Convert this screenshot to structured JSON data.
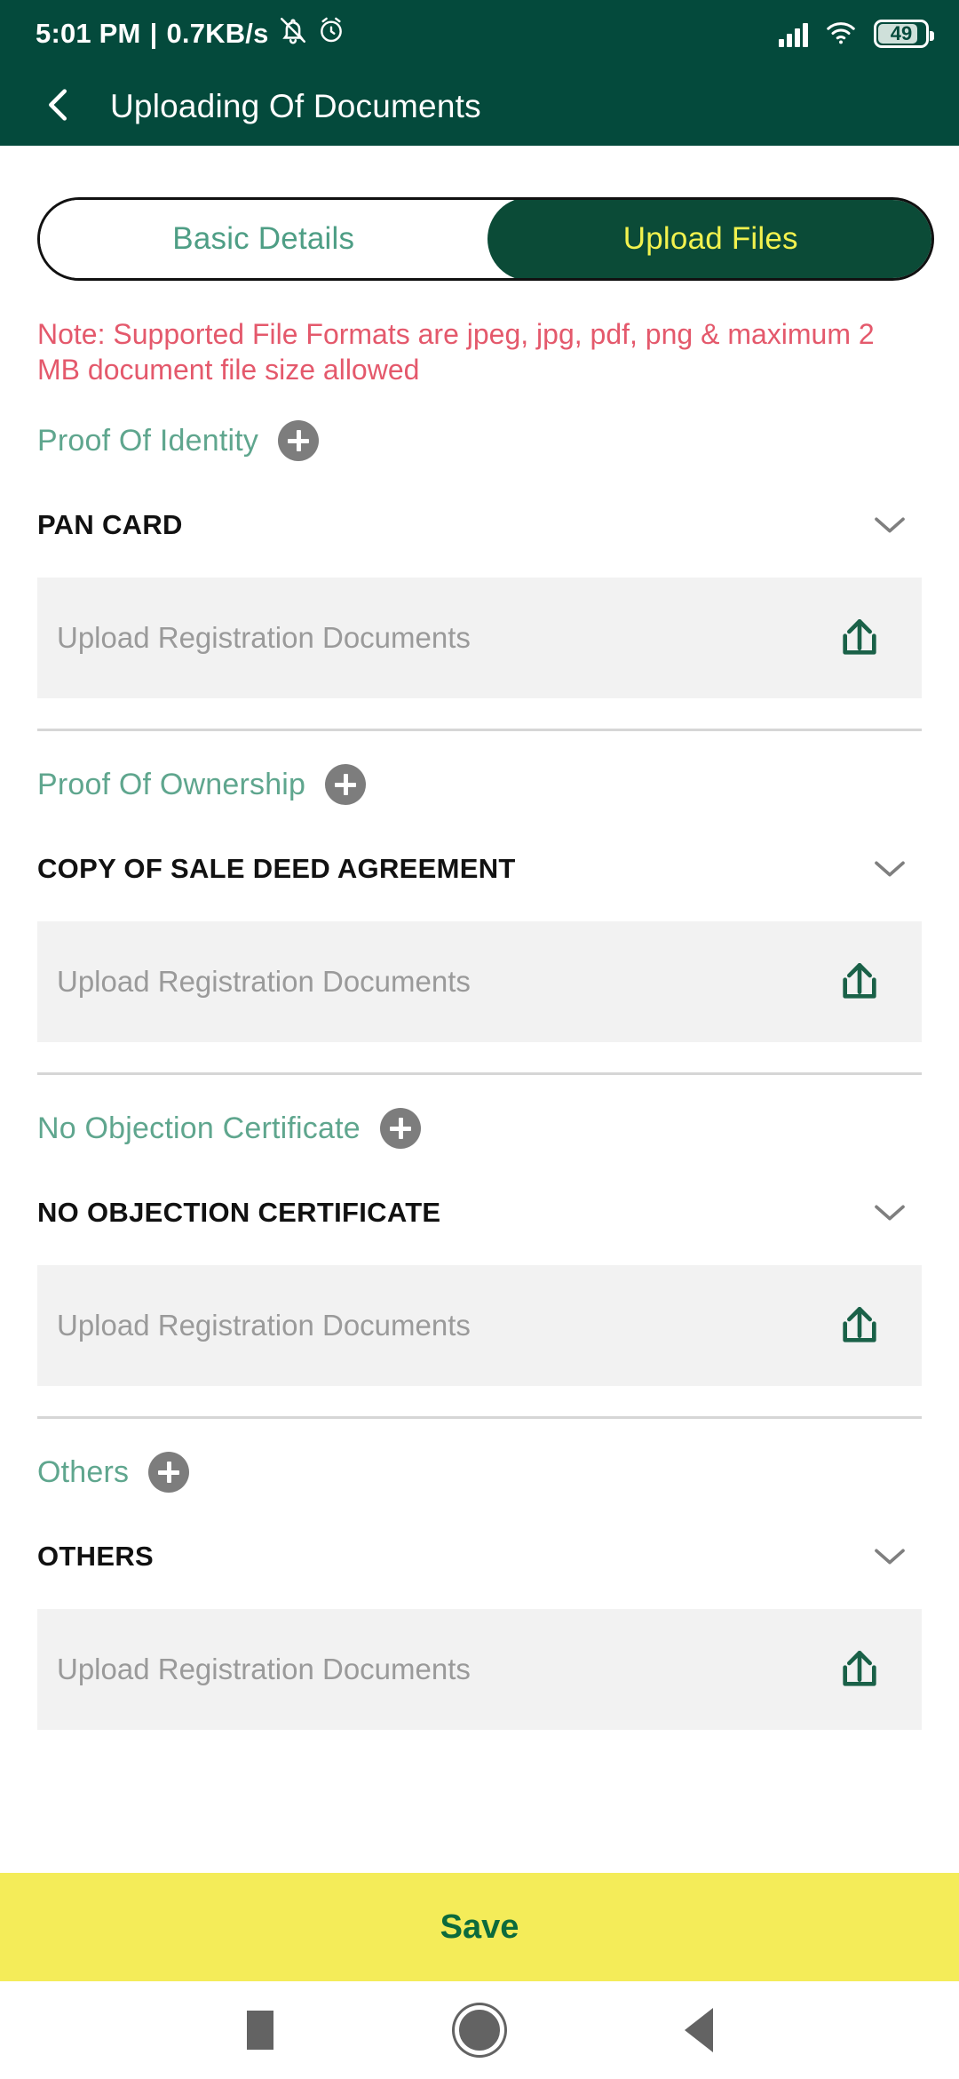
{
  "status_bar": {
    "time": "5:01 PM",
    "separator": "|",
    "network_speed": "0.7KB/s",
    "mute_icon": "bell-muted-icon",
    "alarm_icon": "alarm-clock-icon",
    "signal_icon": "cellular-signal-icon",
    "wifi_icon": "wifi-icon",
    "battery_percent": "49",
    "bar_color": "#044A3C"
  },
  "app_bar": {
    "back_icon": "back-chevron-icon",
    "title": "Uploading Of Documents",
    "background": "#044A3C",
    "title_color": "#FFFFFF"
  },
  "tabs": {
    "items": [
      {
        "label": "Basic Details",
        "active": false
      },
      {
        "label": "Upload Files",
        "active": true
      }
    ],
    "active_bg": "#0B4B37",
    "active_text": "#F2F24E",
    "inactive_text": "#4E9E85"
  },
  "note": {
    "text": "Note: Supported File Formats are jpeg, jpg, pdf, png & maximum 2 MB document file size allowed",
    "color": "#E4596C"
  },
  "sections": [
    {
      "title": "Proof Of Identity",
      "add_icon": "plus-circle-icon",
      "document_name": "PAN CARD",
      "chevron_icon": "chevron-down-icon",
      "upload_placeholder": "Upload Registration Documents",
      "upload_icon": "upload-icon",
      "show_divider": false
    },
    {
      "title": "Proof Of Ownership",
      "add_icon": "plus-circle-icon",
      "document_name": "COPY OF SALE DEED AGREEMENT",
      "chevron_icon": "chevron-down-icon",
      "upload_placeholder": "Upload Registration Documents",
      "upload_icon": "upload-icon",
      "show_divider": true
    },
    {
      "title": "No Objection Certificate",
      "add_icon": "plus-circle-icon",
      "document_name": "NO OBJECTION CERTIFICATE",
      "chevron_icon": "chevron-down-icon",
      "upload_placeholder": "Upload Registration Documents",
      "upload_icon": "upload-icon",
      "show_divider": true
    },
    {
      "title": "Others",
      "add_icon": "plus-circle-icon",
      "document_name": "OTHERS",
      "chevron_icon": "chevron-down-icon",
      "upload_placeholder": "Upload Registration Documents",
      "upload_icon": "upload-icon",
      "show_divider": true
    }
  ],
  "save_bar": {
    "label": "Save",
    "background": "#F4EC59",
    "text_color": "#0C6B3C"
  },
  "nav_bar": {
    "recents_icon": "square-recents-icon",
    "home_icon": "circle-home-icon",
    "back_icon": "triangle-back-icon"
  }
}
